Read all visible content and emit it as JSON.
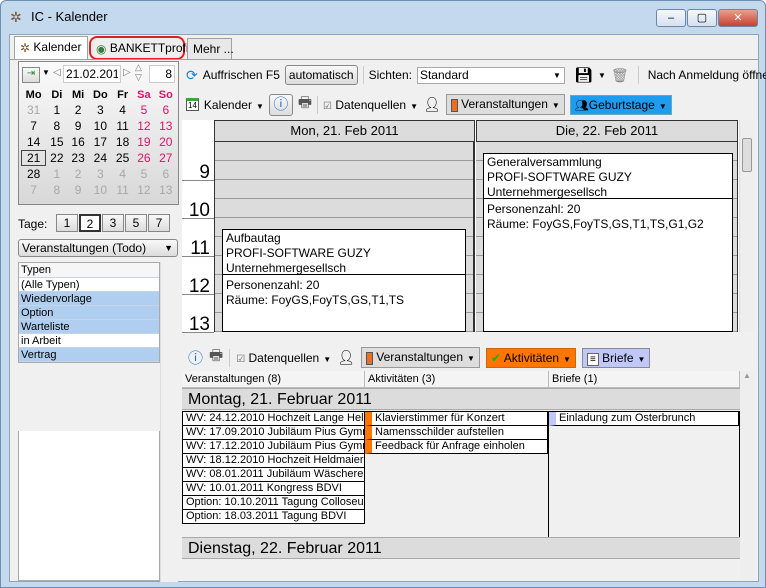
{
  "window": {
    "title": "IC - Kalender",
    "controls": [
      "–",
      "▢",
      "✕"
    ]
  },
  "tabs": [
    {
      "label": "Kalender"
    },
    {
      "label": "BANKETTprofi"
    },
    {
      "label": "Mehr ..."
    }
  ],
  "calendar": {
    "date": "21.02.2011",
    "weeks_value": "8",
    "weekdays": [
      "Mo",
      "Di",
      "Mi",
      "Do",
      "Fr",
      "Sa",
      "So"
    ],
    "rows": [
      [
        "31",
        "1",
        "2",
        "3",
        "4",
        "5",
        "6"
      ],
      [
        "7",
        "8",
        "9",
        "10",
        "11",
        "12",
        "13"
      ],
      [
        "14",
        "15",
        "16",
        "17",
        "18",
        "19",
        "20"
      ],
      [
        "21",
        "22",
        "23",
        "24",
        "25",
        "26",
        "27"
      ],
      [
        "28",
        "1",
        "2",
        "3",
        "4",
        "5",
        "6"
      ],
      [
        "7",
        "8",
        "9",
        "10",
        "11",
        "12",
        "13"
      ]
    ],
    "selected": "21"
  },
  "days": {
    "label": "Tage:",
    "options": [
      "1",
      "2",
      "3",
      "5",
      "7"
    ],
    "selected": "2"
  },
  "filter_select": "Veranstaltungen (Todo)",
  "types": {
    "header": "Typen",
    "items": [
      {
        "label": "(Alle Typen)",
        "selected": false
      },
      {
        "label": "Wiedervorlage",
        "selected": true
      },
      {
        "label": "Option",
        "selected": true
      },
      {
        "label": "Warteliste",
        "selected": true
      },
      {
        "label": "in Arbeit",
        "selected": false
      },
      {
        "label": "Vertrag",
        "selected": true
      }
    ]
  },
  "toolbar1": {
    "refresh": "Auffrischen F5",
    "auto": "automatisch",
    "views_label": "Sichten:",
    "view": "Standard",
    "open_after_login": "Nach Anmeldung öffnen"
  },
  "toolbar2": {
    "calendar": "Kalender",
    "datasources": "Datenquellen",
    "events": "Veranstaltungen",
    "birthdays": "Geburtstage"
  },
  "schedule": {
    "days": [
      "Mon, 21. Feb 2011",
      "Die, 22. Feb 2011"
    ],
    "hours": [
      "9",
      "10",
      "11",
      "12",
      "13"
    ],
    "events": [
      {
        "title": "Aufbautag",
        "company": "PROFI-SOFTWARE GUZY",
        "subtitle": "Unternehmergesellsch",
        "persons": "Personenzahl: 20",
        "rooms": "Räume: FoyGS,FoyTS,GS,T1,TS"
      },
      {
        "title": "Generalversammlung",
        "company": "PROFI-SOFTWARE GUZY",
        "subtitle": "Unternehmergesellsch",
        "persons": "Personenzahl: 20",
        "rooms": "Räume: FoyGS,FoyTS,GS,T1,TS,G1,G2"
      }
    ]
  },
  "toolbar3": {
    "datasources": "Datenquellen",
    "events": "Veranstaltungen",
    "activities": "Aktivitäten",
    "letters": "Briefe"
  },
  "agenda": {
    "columns": [
      "Veranstaltungen (8)",
      "Aktivitäten (3)",
      "Briefe (1)"
    ],
    "groups": [
      {
        "title": "Montag, 21. Februar 2011",
        "events": [
          "WV: 24.12.2010 Hochzeit Lange Hel",
          "WV: 17.09.2010 Jubiläum Pius Gymn",
          "WV: 17.12.2010 Jubiläum Pius Gymn",
          "WV: 18.12.2010 Hochzeit Heldmaier",
          "WV: 08.01.2011 Jubiläum Wäscherei",
          "WV: 10.01.2011 Kongress BDVI",
          "Option: 10.10.2011 Tagung Colloseur",
          "Option: 18.03.2011 Tagung BDVI"
        ],
        "activities": [
          "Klavierstimmer für Konzert",
          "Namensschilder aufstellen",
          "Feedback für Anfrage einholen"
        ],
        "letters": [
          "Einladung zum Osterbrunch"
        ]
      },
      {
        "title": "Dienstag, 22. Februar 2011"
      }
    ]
  },
  "colors": {
    "activities": "#ff7700",
    "birthdays": "#1e9cf0",
    "letters": "#c0c8f8",
    "weekend": "#e0106a",
    "selected_type": "#b0cff0"
  }
}
